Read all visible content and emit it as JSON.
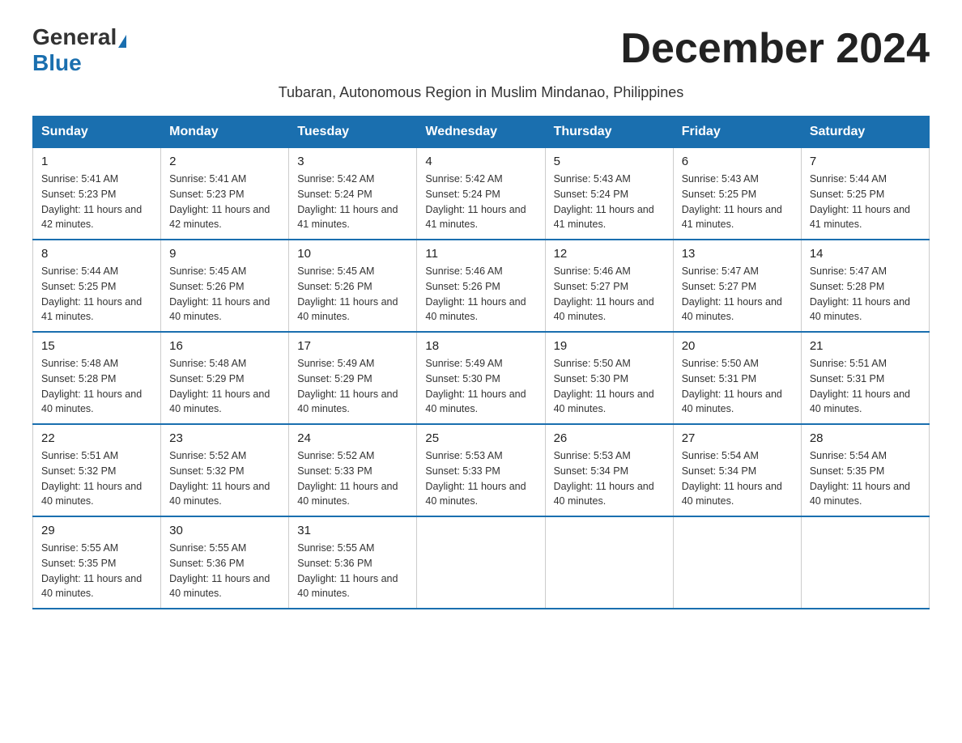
{
  "logo": {
    "general": "General",
    "blue": "Blue"
  },
  "title": "December 2024",
  "subtitle": "Tubaran, Autonomous Region in Muslim Mindanao, Philippines",
  "days_header": [
    "Sunday",
    "Monday",
    "Tuesday",
    "Wednesday",
    "Thursday",
    "Friday",
    "Saturday"
  ],
  "weeks": [
    [
      {
        "day": "1",
        "sunrise": "Sunrise: 5:41 AM",
        "sunset": "Sunset: 5:23 PM",
        "daylight": "Daylight: 11 hours and 42 minutes."
      },
      {
        "day": "2",
        "sunrise": "Sunrise: 5:41 AM",
        "sunset": "Sunset: 5:23 PM",
        "daylight": "Daylight: 11 hours and 42 minutes."
      },
      {
        "day": "3",
        "sunrise": "Sunrise: 5:42 AM",
        "sunset": "Sunset: 5:24 PM",
        "daylight": "Daylight: 11 hours and 41 minutes."
      },
      {
        "day": "4",
        "sunrise": "Sunrise: 5:42 AM",
        "sunset": "Sunset: 5:24 PM",
        "daylight": "Daylight: 11 hours and 41 minutes."
      },
      {
        "day": "5",
        "sunrise": "Sunrise: 5:43 AM",
        "sunset": "Sunset: 5:24 PM",
        "daylight": "Daylight: 11 hours and 41 minutes."
      },
      {
        "day": "6",
        "sunrise": "Sunrise: 5:43 AM",
        "sunset": "Sunset: 5:25 PM",
        "daylight": "Daylight: 11 hours and 41 minutes."
      },
      {
        "day": "7",
        "sunrise": "Sunrise: 5:44 AM",
        "sunset": "Sunset: 5:25 PM",
        "daylight": "Daylight: 11 hours and 41 minutes."
      }
    ],
    [
      {
        "day": "8",
        "sunrise": "Sunrise: 5:44 AM",
        "sunset": "Sunset: 5:25 PM",
        "daylight": "Daylight: 11 hours and 41 minutes."
      },
      {
        "day": "9",
        "sunrise": "Sunrise: 5:45 AM",
        "sunset": "Sunset: 5:26 PM",
        "daylight": "Daylight: 11 hours and 40 minutes."
      },
      {
        "day": "10",
        "sunrise": "Sunrise: 5:45 AM",
        "sunset": "Sunset: 5:26 PM",
        "daylight": "Daylight: 11 hours and 40 minutes."
      },
      {
        "day": "11",
        "sunrise": "Sunrise: 5:46 AM",
        "sunset": "Sunset: 5:26 PM",
        "daylight": "Daylight: 11 hours and 40 minutes."
      },
      {
        "day": "12",
        "sunrise": "Sunrise: 5:46 AM",
        "sunset": "Sunset: 5:27 PM",
        "daylight": "Daylight: 11 hours and 40 minutes."
      },
      {
        "day": "13",
        "sunrise": "Sunrise: 5:47 AM",
        "sunset": "Sunset: 5:27 PM",
        "daylight": "Daylight: 11 hours and 40 minutes."
      },
      {
        "day": "14",
        "sunrise": "Sunrise: 5:47 AM",
        "sunset": "Sunset: 5:28 PM",
        "daylight": "Daylight: 11 hours and 40 minutes."
      }
    ],
    [
      {
        "day": "15",
        "sunrise": "Sunrise: 5:48 AM",
        "sunset": "Sunset: 5:28 PM",
        "daylight": "Daylight: 11 hours and 40 minutes."
      },
      {
        "day": "16",
        "sunrise": "Sunrise: 5:48 AM",
        "sunset": "Sunset: 5:29 PM",
        "daylight": "Daylight: 11 hours and 40 minutes."
      },
      {
        "day": "17",
        "sunrise": "Sunrise: 5:49 AM",
        "sunset": "Sunset: 5:29 PM",
        "daylight": "Daylight: 11 hours and 40 minutes."
      },
      {
        "day": "18",
        "sunrise": "Sunrise: 5:49 AM",
        "sunset": "Sunset: 5:30 PM",
        "daylight": "Daylight: 11 hours and 40 minutes."
      },
      {
        "day": "19",
        "sunrise": "Sunrise: 5:50 AM",
        "sunset": "Sunset: 5:30 PM",
        "daylight": "Daylight: 11 hours and 40 minutes."
      },
      {
        "day": "20",
        "sunrise": "Sunrise: 5:50 AM",
        "sunset": "Sunset: 5:31 PM",
        "daylight": "Daylight: 11 hours and 40 minutes."
      },
      {
        "day": "21",
        "sunrise": "Sunrise: 5:51 AM",
        "sunset": "Sunset: 5:31 PM",
        "daylight": "Daylight: 11 hours and 40 minutes."
      }
    ],
    [
      {
        "day": "22",
        "sunrise": "Sunrise: 5:51 AM",
        "sunset": "Sunset: 5:32 PM",
        "daylight": "Daylight: 11 hours and 40 minutes."
      },
      {
        "day": "23",
        "sunrise": "Sunrise: 5:52 AM",
        "sunset": "Sunset: 5:32 PM",
        "daylight": "Daylight: 11 hours and 40 minutes."
      },
      {
        "day": "24",
        "sunrise": "Sunrise: 5:52 AM",
        "sunset": "Sunset: 5:33 PM",
        "daylight": "Daylight: 11 hours and 40 minutes."
      },
      {
        "day": "25",
        "sunrise": "Sunrise: 5:53 AM",
        "sunset": "Sunset: 5:33 PM",
        "daylight": "Daylight: 11 hours and 40 minutes."
      },
      {
        "day": "26",
        "sunrise": "Sunrise: 5:53 AM",
        "sunset": "Sunset: 5:34 PM",
        "daylight": "Daylight: 11 hours and 40 minutes."
      },
      {
        "day": "27",
        "sunrise": "Sunrise: 5:54 AM",
        "sunset": "Sunset: 5:34 PM",
        "daylight": "Daylight: 11 hours and 40 minutes."
      },
      {
        "day": "28",
        "sunrise": "Sunrise: 5:54 AM",
        "sunset": "Sunset: 5:35 PM",
        "daylight": "Daylight: 11 hours and 40 minutes."
      }
    ],
    [
      {
        "day": "29",
        "sunrise": "Sunrise: 5:55 AM",
        "sunset": "Sunset: 5:35 PM",
        "daylight": "Daylight: 11 hours and 40 minutes."
      },
      {
        "day": "30",
        "sunrise": "Sunrise: 5:55 AM",
        "sunset": "Sunset: 5:36 PM",
        "daylight": "Daylight: 11 hours and 40 minutes."
      },
      {
        "day": "31",
        "sunrise": "Sunrise: 5:55 AM",
        "sunset": "Sunset: 5:36 PM",
        "daylight": "Daylight: 11 hours and 40 minutes."
      },
      null,
      null,
      null,
      null
    ]
  ]
}
